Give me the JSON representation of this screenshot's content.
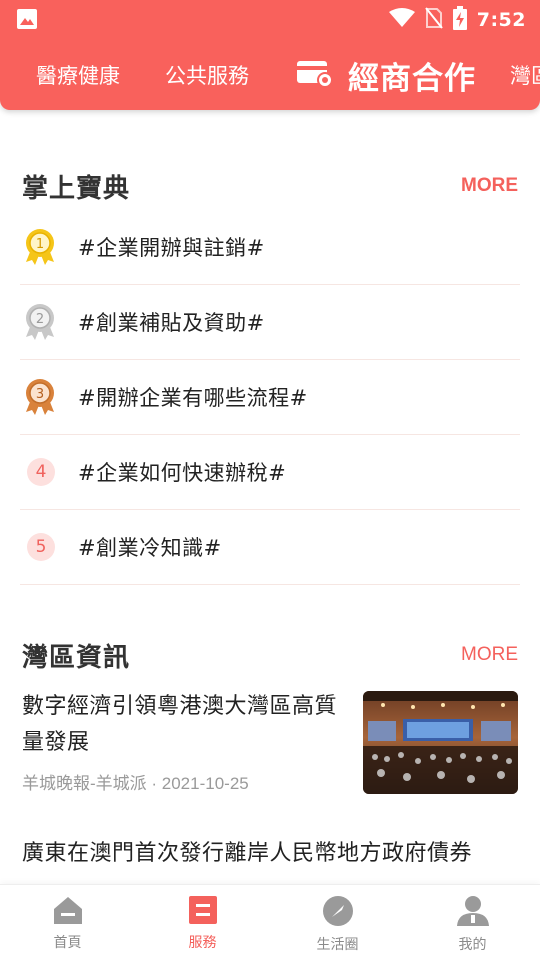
{
  "status_bar": {
    "time": "7:52"
  },
  "top_tabs": [
    {
      "label": "醫療健康"
    },
    {
      "label": "公共服務"
    },
    {
      "label": "經商合作",
      "icon": "wallet-card-icon",
      "active": true
    },
    {
      "label": "灣區"
    }
  ],
  "handbook": {
    "title": "掌上寶典",
    "more": "MORE",
    "items": [
      {
        "rank": "1",
        "medal": "gold-medal-icon",
        "text": "#企業開辦與註銷#"
      },
      {
        "rank": "2",
        "medal": "silver-medal-icon",
        "text": "#創業補貼及資助#"
      },
      {
        "rank": "3",
        "medal": "bronze-medal-icon",
        "text": "#開辦企業有哪些流程#"
      },
      {
        "rank": "4",
        "text": "#企業如何快速辦稅#"
      },
      {
        "rank": "5",
        "text": "#創業冷知識#"
      }
    ]
  },
  "bay_news": {
    "title": "灣區資訊",
    "more": "MORE",
    "articles": [
      {
        "title": "數字經濟引領粵港澳大灣區高質量發展",
        "meta": "羊城晚報-羊城派 · 2021-10-25",
        "has_image": true
      },
      {
        "title": "廣東在澳門首次發行離岸人民幣地方政府債券"
      }
    ]
  },
  "bottom_nav": [
    {
      "label": "首頁",
      "icon": "home-icon"
    },
    {
      "label": "服務",
      "icon": "service-icon",
      "active": true
    },
    {
      "label": "生活圈",
      "icon": "compass-icon"
    },
    {
      "label": "我的",
      "icon": "person-icon"
    }
  ],
  "colors": {
    "brand": "#f9615c",
    "accent_text": "#f4615c",
    "gold": "#f5c518",
    "silver": "#c8c8c8",
    "bronze": "#d9823b",
    "nav_inactive": "#9a9a9a"
  }
}
